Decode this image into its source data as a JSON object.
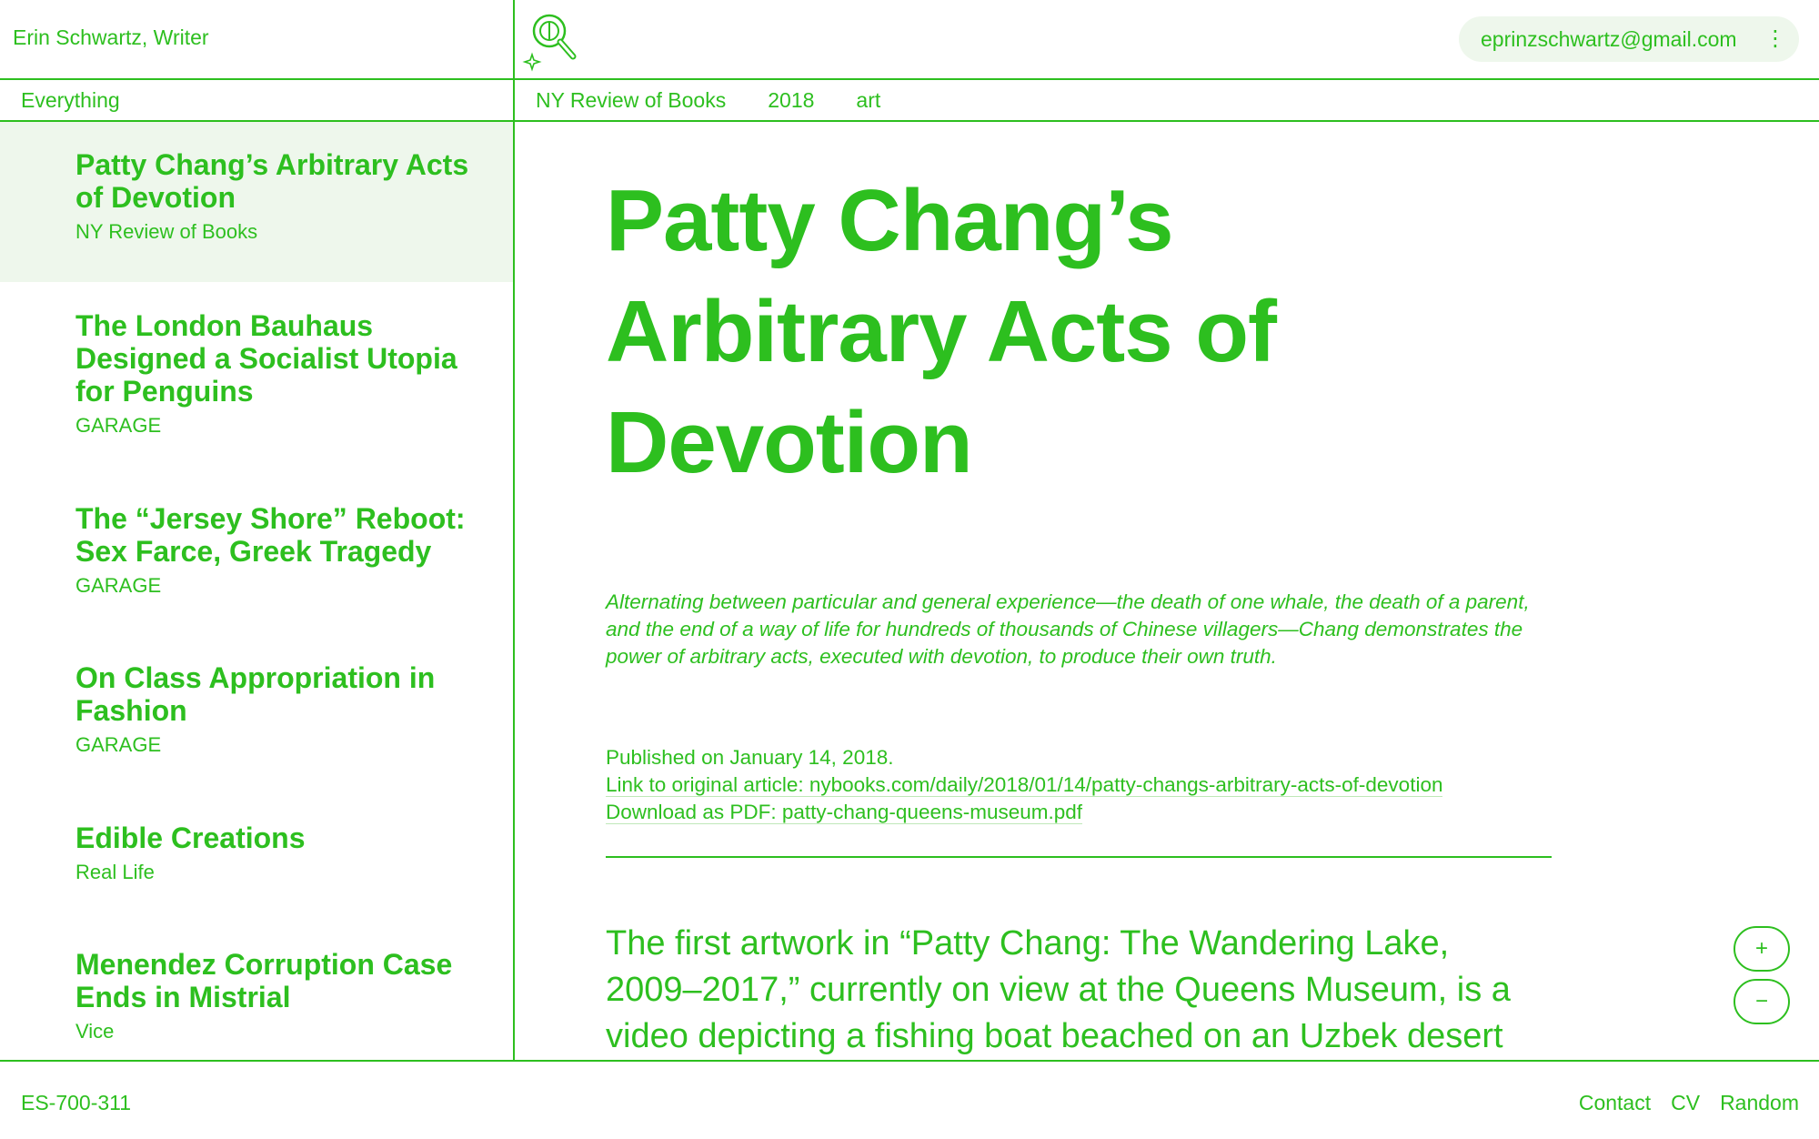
{
  "header": {
    "site_name": "Erin Schwartz, Writer",
    "logo_icon": "magnifier-sparkle-icon",
    "account_email": "eprinzschwartz@gmail.com",
    "menu_icon": "⋮"
  },
  "filters": {
    "all_label": "Everything",
    "tags": [
      "NY Review of Books",
      "2018",
      "art"
    ]
  },
  "sidebar": {
    "items": [
      {
        "title": "Patty Chang’s Arbitrary Acts of Devotion",
        "source": "NY Review of Books",
        "active": true
      },
      {
        "title": "The London Bauhaus Designed a Socialist Utopia for Penguins",
        "source": "GARAGE",
        "active": false
      },
      {
        "title": "The “Jersey Shore” Reboot: Sex Farce, Greek Tragedy",
        "source": "GARAGE",
        "active": false
      },
      {
        "title": "On Class Appropriation in Fashion",
        "source": "GARAGE",
        "active": false
      },
      {
        "title": "Edible Creations",
        "source": "Real Life",
        "active": false
      },
      {
        "title": "Menendez Corruption Case Ends in Mistrial",
        "source": "Vice",
        "active": false
      }
    ]
  },
  "article": {
    "title": "Patty Chang’s Arbitrary Acts of Devotion",
    "dek": "Alternating between particular and general experience—the death of one whale, the death of a parent, and the end of a way of life for hundreds of thousands of Chinese villagers—Chang demonstrates the power of arbitrary acts, executed with devotion, to produce their own truth.",
    "published": "Published on January 14, 2018.",
    "link_label": "Link to original article: ",
    "link_url": "nybooks.com/daily/2018/01/14/patty-changs-arbitrary-acts-of-devotion",
    "pdf_label": "Download as PDF: ",
    "pdf_file": "patty-chang-queens-museum.pdf",
    "body": "The first artwork in “Patty Chang: The Wandering Lake, 2009–2017,” currently on view at the Queens Museum, is a video depicting a fishing boat beached on an Uzbek desert"
  },
  "zoom": {
    "in_label": "+",
    "out_label": "−"
  },
  "footer": {
    "code": "ES-700-311",
    "links": [
      "Contact",
      "CV",
      "Random"
    ]
  },
  "colors": {
    "accent": "#2dbf1f",
    "active_bg": "#eef7ec",
    "background": "#ffffff"
  }
}
